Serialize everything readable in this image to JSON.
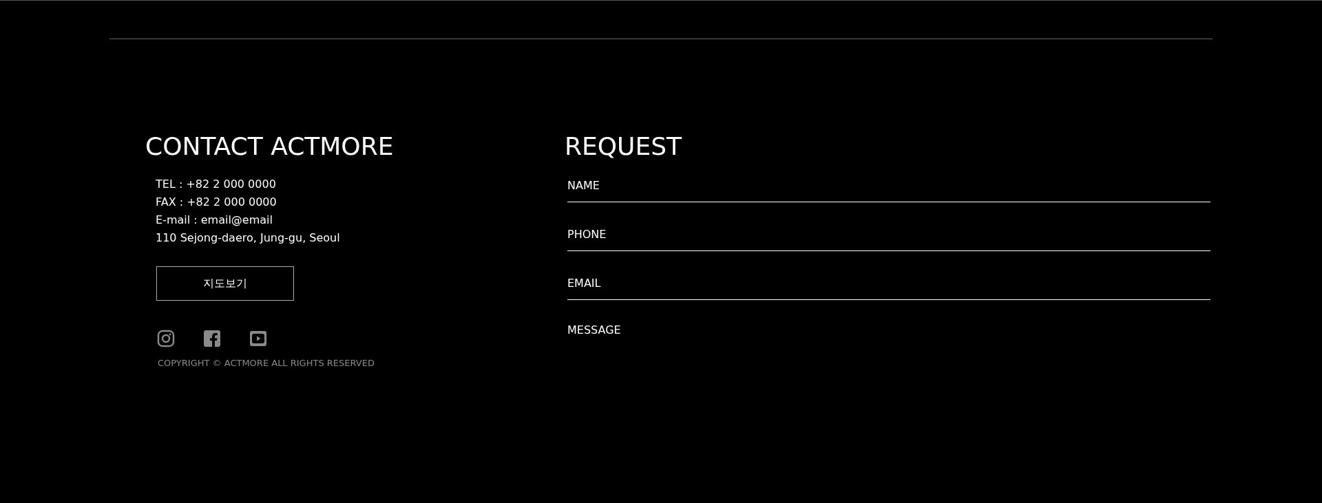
{
  "contact": {
    "title": "CONTACT ACTMORE",
    "lines": [
      "TEL : +82 2 000 0000",
      "FAX : +82 2 000 0000",
      "E-mail : email@email",
      "110 Sejong-daero, Jung-gu, Seoul"
    ],
    "map_button": "지도보기",
    "social": [
      {
        "kind": "instagram"
      },
      {
        "kind": "facebook"
      },
      {
        "kind": "youtube"
      }
    ],
    "copyright": "COPYRIGHT © ACTMORE ALL RIGHTS RESERVED"
  },
  "request": {
    "title": "REQUEST",
    "fields": [
      {
        "kind": "line",
        "placeholder": "NAME"
      },
      {
        "kind": "line",
        "placeholder": "PHONE"
      },
      {
        "kind": "line",
        "placeholder": "EMAIL"
      },
      {
        "kind": "area",
        "placeholder": "MESSAGE"
      }
    ]
  }
}
